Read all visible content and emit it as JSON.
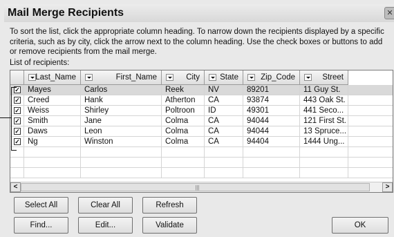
{
  "dialog": {
    "title": "Mail Merge Recipients",
    "close_glyph": "✕",
    "instructions": "To sort the list, click the appropriate column heading.  To narrow down the recipients displayed by a specific criteria, such as by city, click the arrow next to the column heading.  Use the check boxes or buttons to add or remove recipients from the mail merge.",
    "list_label": "List of recipients:"
  },
  "columns": [
    "Last_Name",
    "First_Name",
    "City",
    "State",
    "Zip_Code",
    "Street"
  ],
  "rows": [
    {
      "checked": true,
      "selected": true,
      "cells": [
        "Mayes",
        "Carlos",
        "Reek",
        "NV",
        "89201",
        "11 Guy St."
      ]
    },
    {
      "checked": true,
      "selected": false,
      "cells": [
        "Creed",
        "Hank",
        "Atherton",
        "CA",
        "93874",
        "443 Oak St."
      ]
    },
    {
      "checked": true,
      "selected": false,
      "cells": [
        "Weiss",
        "Shirley",
        "Poltroon",
        "ID",
        "49301",
        "441 Seco..."
      ]
    },
    {
      "checked": true,
      "selected": false,
      "cells": [
        "Smith",
        "Jane",
        "Colma",
        "CA",
        "94044",
        "121 First St."
      ]
    },
    {
      "checked": true,
      "selected": false,
      "cells": [
        "Daws",
        "Leon",
        "Colma",
        "CA",
        "94044",
        "13 Spruce..."
      ]
    },
    {
      "checked": true,
      "selected": false,
      "cells": [
        "Ng",
        "Winston",
        "Colma",
        "CA",
        "94404",
        "1444 Ung..."
      ]
    }
  ],
  "scroll": {
    "left_glyph": "<",
    "right_glyph": ">",
    "grip": "|||"
  },
  "buttons": {
    "select_all": "Select All",
    "clear_all": "Clear All",
    "refresh": "Refresh",
    "find": "Find...",
    "edit": "Edit...",
    "validate": "Validate",
    "ok": "OK"
  }
}
